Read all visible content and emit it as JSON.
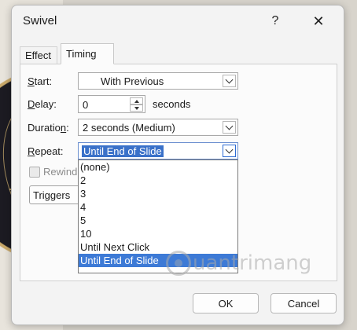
{
  "window": {
    "title": "Swivel",
    "help_label": "?",
    "close_label": "✕"
  },
  "tabs": [
    {
      "label": "Effect",
      "active": false
    },
    {
      "label": "Timing",
      "active": true
    }
  ],
  "timing": {
    "start": {
      "label_mnemonic": "S",
      "label_rest": "tart:",
      "value": "With Previous"
    },
    "delay": {
      "label_mnemonic": "D",
      "label_rest": "elay:",
      "value": "0",
      "unit": "seconds"
    },
    "duration": {
      "label_prefix": "Duratio",
      "label_mnemonic": "n",
      "label_rest": ":",
      "value": "2 seconds (Medium)"
    },
    "repeat": {
      "label_mnemonic": "R",
      "label_rest": "epeat:",
      "value": "Until End of Slide"
    },
    "rewind": {
      "label": "Rewind",
      "checked": false,
      "enabled": false
    },
    "triggers_label": "Triggers"
  },
  "repeat_dropdown": {
    "options": [
      "(none)",
      "2",
      "3",
      "4",
      "5",
      "10",
      "Until Next Click",
      "Until End of Slide"
    ],
    "selected_index": 7
  },
  "watermark": {
    "text": "uantrimang",
    "icon": "bulb-logo-icon"
  },
  "buttons": {
    "ok": "OK",
    "cancel": "Cancel"
  },
  "colors": {
    "selection": "#3d7ad6",
    "dialog_bg": "#f3f3f3"
  }
}
